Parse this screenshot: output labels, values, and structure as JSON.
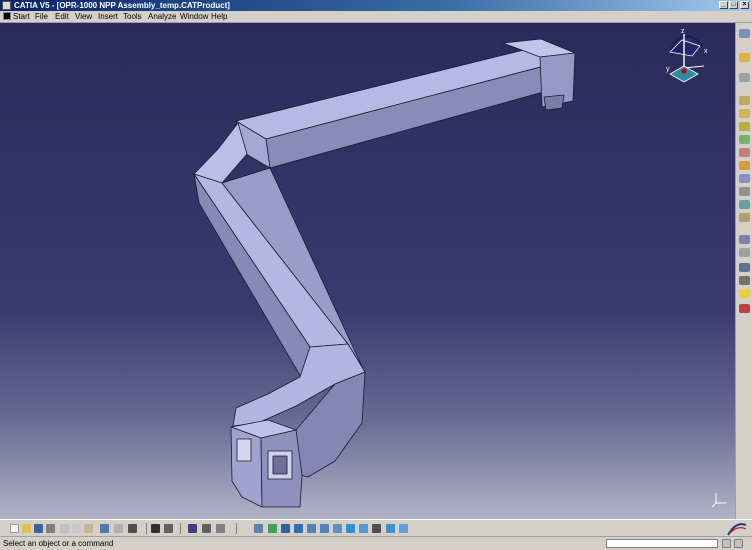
{
  "window": {
    "title": "CATIA V5 - [OPR-1000 NPP Assembly_temp.CATProduct]"
  },
  "window_buttons": {
    "minimize": "_",
    "maximize": "□",
    "close": "×"
  },
  "menu": {
    "items": [
      "Start",
      "File",
      "Edit",
      "View",
      "Insert",
      "Tools",
      "Analyze",
      "Window",
      "Help"
    ]
  },
  "compass": {
    "z_label": "z",
    "x_label": "x",
    "y_label": "y"
  },
  "status": {
    "message": "Select an object or a command"
  },
  "command_input": {
    "value": ""
  },
  "right_toolbar_icons": [
    "tools-palette-icon",
    "select-icon",
    "product-structure-icon",
    "gear-icon",
    "assembly-constraint-icon",
    "move-icon",
    "snap-icon",
    "explode-icon",
    "clash-icon",
    "section-icon",
    "distance-icon",
    "sectioning-icon",
    "annotation-icon",
    "catalog-icon",
    "bill-of-materials-icon",
    "scenes-icon",
    "publication-icon",
    "lightbulb-icon",
    "delete-icon"
  ],
  "bottom_toolbar_icons": [
    "new-icon",
    "open-icon",
    "save-icon",
    "print-icon",
    "cut-icon",
    "copy-icon",
    "paste-icon",
    "undo-icon",
    "redo-icon",
    "whats-this-icon",
    "formula-icon",
    "comment-icon",
    "catalog-icon",
    "measure-icon",
    "inertia-icon",
    "fly-mode-icon",
    "fit-all-icon",
    "pan-icon",
    "rotate-icon",
    "zoom-in-icon",
    "zoom-out-icon",
    "normal-view-icon",
    "multi-view-icon",
    "iso-view-icon",
    "shading-icon",
    "hide-show-icon",
    "swap-visible-icon"
  ],
  "colors": {
    "viewport_top": "#2b2a5c",
    "viewport_bottom": "#b2b2c8",
    "model_face": "#b6b6e2",
    "model_side": "#8a8ab8",
    "model_edge": "#1a1a2e",
    "title_bar": "#0a246a"
  }
}
